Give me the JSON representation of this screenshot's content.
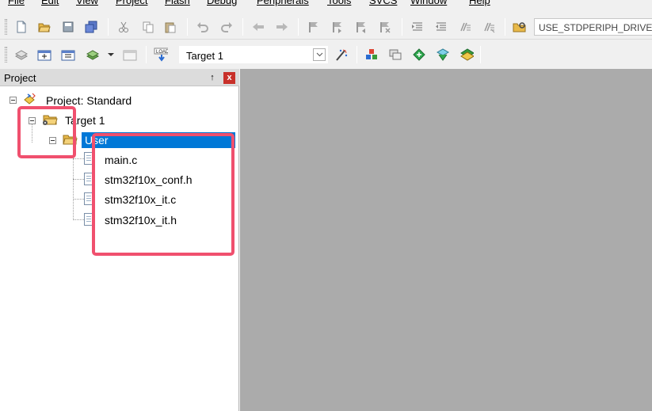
{
  "menu": [
    "File",
    "Edit",
    "View",
    "Project",
    "Flash",
    "Debug",
    "Peripherals",
    "Tools",
    "SVCS",
    "Window",
    "Help"
  ],
  "toolbar1": {
    "find_value": "USE_STDPERIPH_DRIVER"
  },
  "toolbar2": {
    "target_value": "Target 1"
  },
  "project_panel": {
    "title": "Project",
    "pin_glyph": "↑",
    "close_glyph": "x"
  },
  "tree": {
    "project": "Project: Standard",
    "target": "Target 1",
    "group": "User",
    "files": [
      "main.c",
      "stm32f10x_conf.h",
      "stm32f10x_it.c",
      "stm32f10x_it.h"
    ]
  },
  "colors": {
    "selection": "#0078d7",
    "annotation": "#f0506e",
    "editor_background": "#ababab"
  }
}
